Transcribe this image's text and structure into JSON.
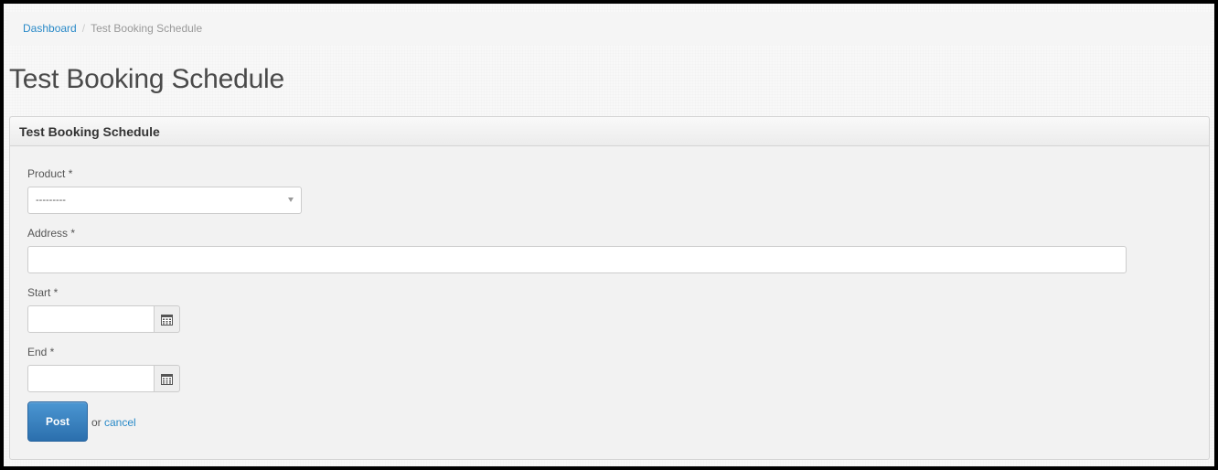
{
  "breadcrumb": {
    "home": "Dashboard",
    "separator": "/",
    "current": "Test Booking Schedule"
  },
  "page": {
    "title": "Test Booking Schedule"
  },
  "panel": {
    "heading": "Test Booking Schedule"
  },
  "form": {
    "product_label": "Product *",
    "product_selected": "---------",
    "address_label": "Address *",
    "address_value": "",
    "start_label": "Start *",
    "start_value": "",
    "end_label": "End *",
    "end_value": ""
  },
  "actions": {
    "post_label": "Post",
    "or_text": "or",
    "cancel_label": "cancel"
  },
  "icons": {
    "calendar": "calendar-icon",
    "caret": "chevron-down-icon"
  },
  "colors": {
    "link": "#2a8ac8",
    "primary_button": "#2b6fad"
  }
}
